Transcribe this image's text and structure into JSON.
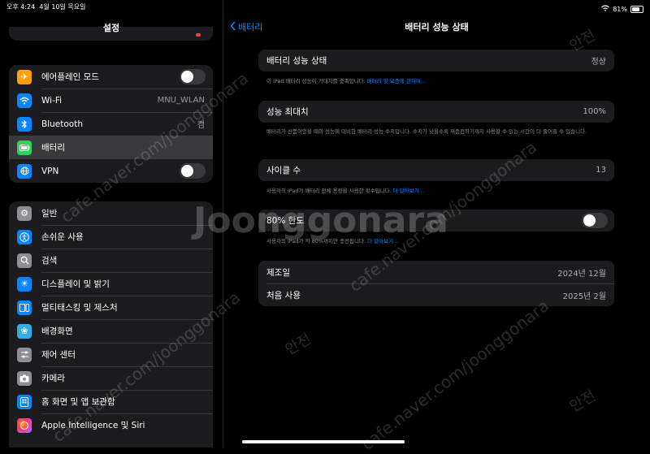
{
  "status_bar": {
    "time": "오후 4:24",
    "date": "4월 10일 목요일",
    "battery_pct": "81%"
  },
  "sidebar": {
    "title": "설정",
    "group1": [
      {
        "label": "에어플레인 모드",
        "icon": "airplane-icon",
        "color": "#ff9f0a",
        "toggle": true
      },
      {
        "label": "Wi-Fi",
        "icon": "wifi-icon",
        "color": "#0a84ff",
        "value": "MNU_WLAN"
      },
      {
        "label": "Bluetooth",
        "icon": "bluetooth-icon",
        "color": "#0a84ff",
        "value": "켬"
      },
      {
        "label": "배터리",
        "icon": "battery-icon",
        "color": "#30d158",
        "selected": true
      },
      {
        "label": "VPN",
        "icon": "vpn-icon",
        "color": "#0a84ff",
        "toggle": true
      }
    ],
    "group2": [
      {
        "label": "일반",
        "icon": "gear-icon",
        "color": "#8e8e93"
      },
      {
        "label": "손쉬운 사용",
        "icon": "accessibility-icon",
        "color": "#0a84ff"
      },
      {
        "label": "검색",
        "icon": "search-icon",
        "color": "#8e8e93"
      },
      {
        "label": "디스플레이 및 밝기",
        "icon": "display-icon",
        "color": "#0a84ff"
      },
      {
        "label": "멀티태스킹 및 제스처",
        "icon": "multitasking-icon",
        "color": "#0a84ff"
      },
      {
        "label": "배경화면",
        "icon": "wallpaper-icon",
        "color": "#32ade6"
      },
      {
        "label": "제어 센터",
        "icon": "control-center-icon",
        "color": "#8e8e93"
      },
      {
        "label": "카메라",
        "icon": "camera-icon",
        "color": "#8e8e93"
      },
      {
        "label": "홈 화면 및 앱 보관함",
        "icon": "home-screen-icon",
        "color": "#0a84ff"
      },
      {
        "label": "Apple Intelligence 및 Siri",
        "icon": "siri-icon",
        "color": "#bf5af2"
      }
    ]
  },
  "main": {
    "back_label": "배터리",
    "title": "배터리 성능 상태",
    "health": {
      "label": "배터리 성능 상태",
      "value": "정상"
    },
    "health_footer": {
      "text": "이 iPad 배터리 성능이 기대치를 충족합니다. ",
      "link": "배터리 및 보증에 관하여..."
    },
    "capacity": {
      "label": "성능 최대치",
      "value": "100%"
    },
    "capacity_footer": "배터리가 신품이었을 때의 성능에 대비한 배터리 성능 수치입니다. 수치가 낮을수록 재충전하기까지 사용할 수 있는 시간이 더 줄어들 수 있습니다.",
    "cycles": {
      "label": "사이클 수",
      "value": "13"
    },
    "cycles_footer": {
      "text": "사용자의 iPad가 배터리 전체 용량을 사용한 횟수입니다. ",
      "link": "더 알아보기..."
    },
    "limit": {
      "label": "80% 한도",
      "toggle": true
    },
    "limit_footer": {
      "text": "사용자의 iPad가 약 80%까지만 충전됩니다. ",
      "link": "더 알아보기..."
    },
    "manufactured": {
      "label": "제조일",
      "value": "2024년 12월"
    },
    "first_use": {
      "label": "처음 사용",
      "value": "2025년 2월"
    }
  },
  "watermark": {
    "brand": "Joonggonara",
    "url": "cafe.naver.com/joonggonara",
    "mark": "안전"
  }
}
